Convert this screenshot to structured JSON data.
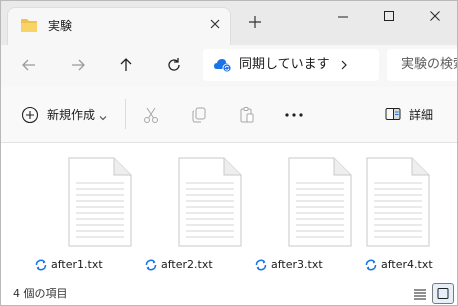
{
  "tab": {
    "title": "実験",
    "close_icon": "close-icon",
    "new_tab_icon": "plus-icon"
  },
  "window_controls": [
    "minimize-icon",
    "maximize-icon",
    "close-icon"
  ],
  "nav": [
    "back-arrow-icon",
    "forward-arrow-icon",
    "up-arrow-icon",
    "refresh-icon"
  ],
  "address": {
    "status_icon": "sync-cloud-icon",
    "text": "同期しています",
    "chevron": "chevron-right-icon"
  },
  "search": {
    "placeholder": "実験の検索"
  },
  "commands": {
    "new_label": "新規作成",
    "cut_icon": "scissors-icon",
    "copy_icon": "copy-icon",
    "paste_icon": "clipboard-icon",
    "more_icon": "more-icon",
    "details_label": "詳細"
  },
  "files": [
    {
      "name": "after1.txt",
      "status_icon": "sync-icon"
    },
    {
      "name": "after2.txt",
      "status_icon": "sync-icon"
    },
    {
      "name": "after3.txt",
      "status_icon": "sync-icon"
    },
    {
      "name": "after4.txt",
      "status_icon": "sync-icon"
    }
  ],
  "status": {
    "item_count": "4 個の項目"
  },
  "colors": {
    "accent": "#0067c0",
    "folder": "#f3c14b",
    "sync": "#1a73e8"
  }
}
